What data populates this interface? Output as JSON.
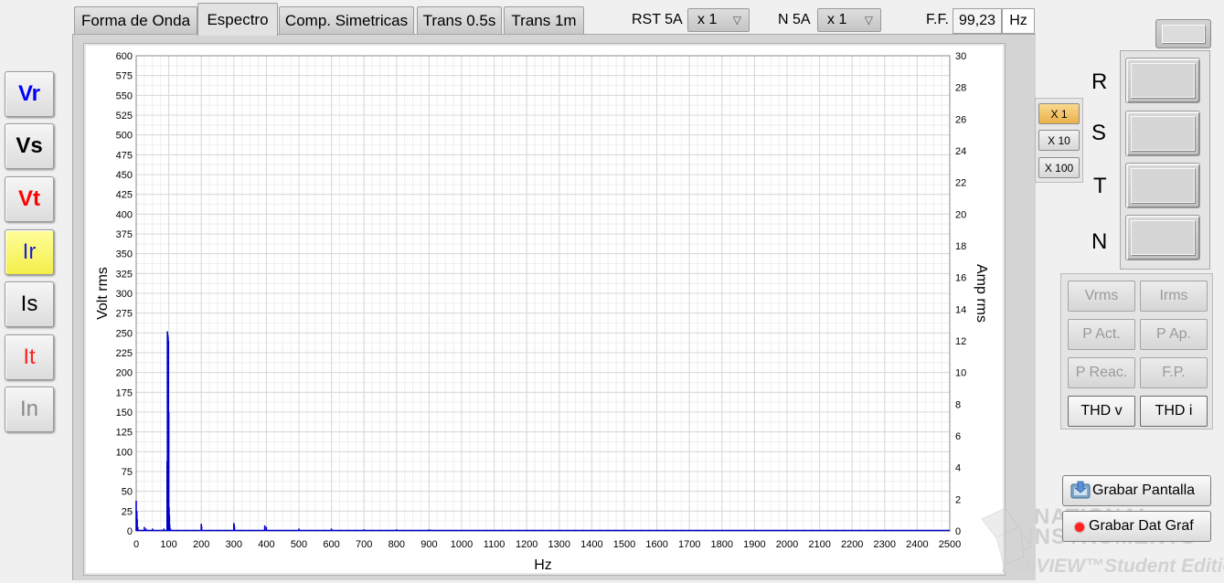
{
  "tabs": [
    {
      "label": "Forma de Onda",
      "selected": false
    },
    {
      "label": "Espectro",
      "selected": true
    },
    {
      "label": "Comp. Simetricas",
      "selected": false
    },
    {
      "label": "Trans 0.5s",
      "selected": false
    },
    {
      "label": "Trans 1m",
      "selected": false
    }
  ],
  "header": {
    "rst_label": "RST 5A",
    "rst_value": "x 1",
    "n_label": "N 5A",
    "n_value": "x 1",
    "ff_label": "F.F.",
    "ff_value": "99,23",
    "ff_unit": "Hz"
  },
  "channels": [
    {
      "label": "Vr",
      "color": "#0000ff",
      "bold": true,
      "active": false
    },
    {
      "label": "Vs",
      "color": "#000000",
      "bold": true,
      "active": false
    },
    {
      "label": "Vt",
      "color": "#ff0000",
      "bold": true,
      "active": false
    },
    {
      "label": "Ir",
      "color": "#2020d0",
      "bold": false,
      "active": true
    },
    {
      "label": "Is",
      "color": "#000000",
      "bold": false,
      "active": false
    },
    {
      "label": "It",
      "color": "#ff2020",
      "bold": false,
      "active": false
    },
    {
      "label": "In",
      "color": "#8a8a8a",
      "bold": false,
      "active": false
    }
  ],
  "multipliers": [
    {
      "label": "X 1",
      "active": true
    },
    {
      "label": "X 10",
      "active": false
    },
    {
      "label": "X 100",
      "active": false
    }
  ],
  "phase_labels": [
    "R",
    "S",
    "T",
    "N"
  ],
  "measure_buttons": [
    {
      "label": "Vrms",
      "enabled": false
    },
    {
      "label": "Irms",
      "enabled": false
    },
    {
      "label": "P Act.",
      "enabled": false
    },
    {
      "label": "P Ap.",
      "enabled": false
    },
    {
      "label": "P Reac.",
      "enabled": false
    },
    {
      "label": "F.P.",
      "enabled": false
    },
    {
      "label": "THD v",
      "enabled": true
    },
    {
      "label": "THD i",
      "enabled": true
    }
  ],
  "actions": {
    "save_screen": "Grabar Pantalla",
    "save_data": "Grabar Dat Graf"
  },
  "watermark": {
    "line1": "NATIONAL",
    "line2": "INSTRUMENTS",
    "line3": "LabVIEW™Student Edition"
  },
  "colors": {
    "trace": "#0000cc",
    "save_data_led": "#ff2020"
  },
  "chart_data": {
    "type": "bar",
    "xlabel": "Hz",
    "ylabel": "Volt rms",
    "y2label": "Amp rms",
    "xlim": [
      0,
      2500
    ],
    "ylim": [
      0,
      600
    ],
    "y2lim": [
      0,
      30
    ],
    "x_ticks": [
      0,
      100,
      200,
      300,
      400,
      500,
      600,
      700,
      800,
      900,
      1000,
      1100,
      1200,
      1300,
      1400,
      1500,
      1600,
      1700,
      1800,
      1900,
      2000,
      2100,
      2200,
      2300,
      2400,
      2500
    ],
    "y_ticks": [
      0,
      25,
      50,
      75,
      100,
      125,
      150,
      175,
      200,
      225,
      250,
      275,
      300,
      325,
      350,
      375,
      400,
      425,
      450,
      475,
      500,
      525,
      550,
      575,
      600
    ],
    "y2_ticks": [
      0,
      2,
      4,
      6,
      8,
      10,
      12,
      14,
      16,
      18,
      20,
      22,
      24,
      26,
      28,
      30
    ],
    "grid": true,
    "series": [
      {
        "x": [
          0,
          2,
          3,
          5,
          25,
          30,
          50,
          85,
          95,
          96,
          97,
          98,
          99,
          100,
          101,
          102,
          103,
          105,
          200,
          201,
          300,
          301,
          302,
          395,
          400,
          500,
          600,
          700,
          800,
          900
        ],
        "values": [
          38,
          25,
          15,
          5,
          5,
          3,
          3,
          3,
          88,
          252,
          248,
          245,
          240,
          150,
          30,
          20,
          8,
          3,
          9,
          6,
          10,
          8,
          5,
          7,
          5,
          3,
          3,
          2,
          2,
          2
        ]
      }
    ]
  }
}
